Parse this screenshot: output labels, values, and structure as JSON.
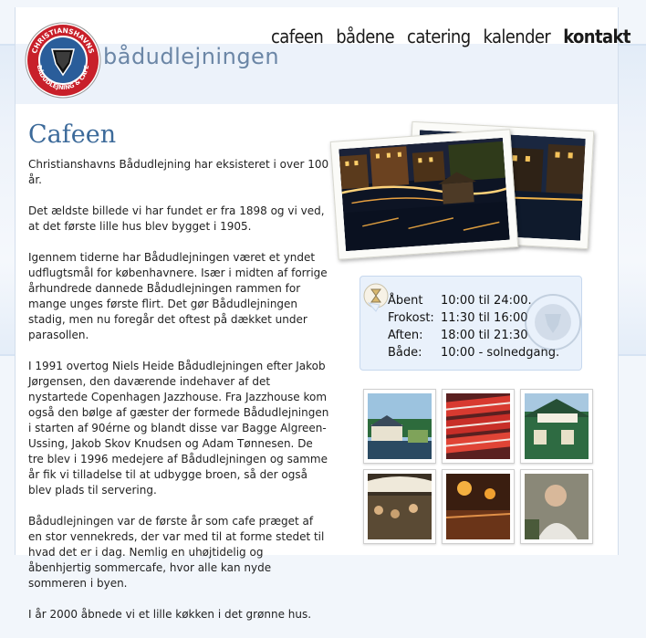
{
  "brand": {
    "name": "bådudlejningen",
    "logo_text": "CHRISTIANSHAVNS BÅDUDLEJNING & CAFE"
  },
  "nav": {
    "items": [
      "cafeen",
      "bådene",
      "catering",
      "kalender",
      "kontakt"
    ],
    "active": "kontakt"
  },
  "main": {
    "title": "Cafeen",
    "paragraphs": [
      "Christianshavns Bådudlejning har eksisteret i over 100 år.",
      "Det ældste billede vi har fundet er fra 1898 og vi ved, at det første lille hus blev bygget i 1905.",
      "Igennem tiderne har Bådudlejningen været et yndet udflugtsmål for københavnere. Især i midten af forrige århundrede dannede Bådudlejningen rammen for mange unges første flirt. Det gør Bådudlejningen stadig, men nu foregår det oftest på dækket under parasollen.",
      "I 1991 overtog Niels Heide Bådudlejningen efter Jakob Jørgensen, den daværende indehaver af det nystartede Copenhagen Jazzhouse. Fra Jazzhouse kom også den bølge af gæster der formede Bådudlejningen i starten af 90érne og blandt disse var Bagge Algreen-Ussing, Jakob Skov Knudsen og Adam Tønnesen. De tre blev i 1996 medejere af Bådudlejningen og samme år fik vi tilladelse til at udbygge broen, så der også blev plads til servering.",
      "Bådudlejningen var de første år som cafe præget af en stor vennekreds, der var med til at forme stedet til hvad det er i dag. Nemlig en uhøjtidelig og åbenhjertig sommercafe, hvor alle kan nyde sommeren i byen.",
      "I år 2000 åbnede vi et lille køkken i det grønne hus."
    ]
  },
  "hours": [
    {
      "label": "Åbent",
      "value": "10:00 til 24:00."
    },
    {
      "label": "Frokost:",
      "value": "11:30 til 16:00"
    },
    {
      "label": "Aften:",
      "value": "18:00 til 21:30"
    },
    {
      "label": "Både:",
      "value": "10:00 - solnedgang."
    }
  ],
  "thumbnails": [
    "boathouse-photo",
    "red-boats-photo",
    "green-house-sign-photo",
    "terrace-photo",
    "cafe-interior-photo",
    "guests-photo"
  ],
  "colors": {
    "title": "#3c6a9a",
    "brand": "#6b86a6",
    "logo_red": "#c8202a",
    "logo_blue": "#2a5d9a"
  }
}
